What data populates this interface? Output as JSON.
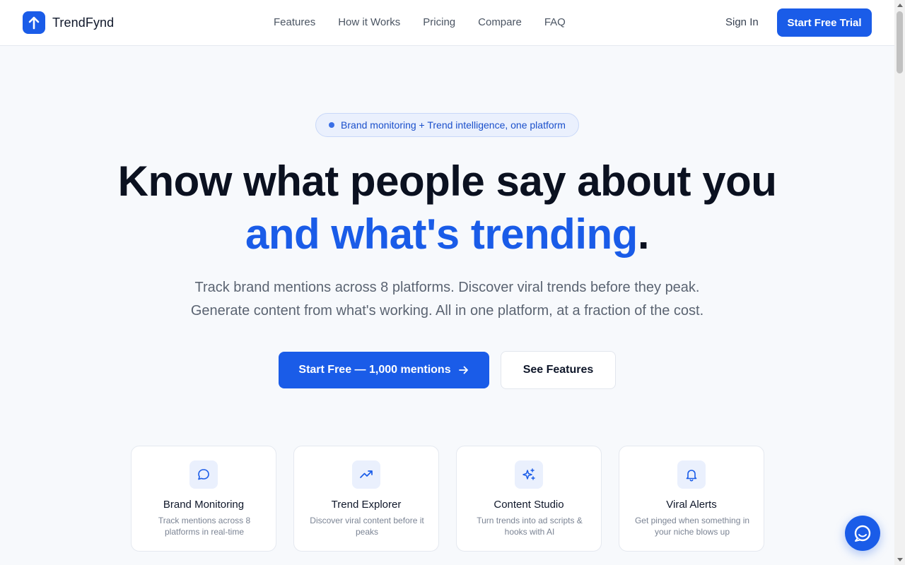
{
  "brand": {
    "name": "TrendFynd",
    "accent": "#1a5ce8"
  },
  "nav": {
    "items": [
      {
        "label": "Features"
      },
      {
        "label": "How it Works"
      },
      {
        "label": "Pricing"
      },
      {
        "label": "Compare"
      },
      {
        "label": "FAQ"
      }
    ],
    "sign_in": "Sign In",
    "trial": "Start Free Trial"
  },
  "hero": {
    "badge": "Brand monitoring + Trend intelligence, one platform",
    "headline_1": "Know what people say about you",
    "headline_2": "and what's trending",
    "headline_2_end": ".",
    "sub_1": "Track brand mentions across 8 platforms. Discover viral trends before they peak.",
    "sub_2": "Generate content from what's working. All in one platform, at a fraction of the cost.",
    "cta_primary": "Start Free — 1,000 mentions",
    "cta_secondary": "See Features"
  },
  "features": [
    {
      "icon": "chat-bubble-icon",
      "title": "Brand Monitoring",
      "desc": "Track mentions across 8 platforms in real-time"
    },
    {
      "icon": "trending-up-icon",
      "title": "Trend Explorer",
      "desc": "Discover viral content before it peaks"
    },
    {
      "icon": "sparkles-icon",
      "title": "Content Studio",
      "desc": "Turn trends into ad scripts & hooks with AI"
    },
    {
      "icon": "bell-icon",
      "title": "Viral Alerts",
      "desc": "Get pinged when something in your niche blows up"
    }
  ]
}
